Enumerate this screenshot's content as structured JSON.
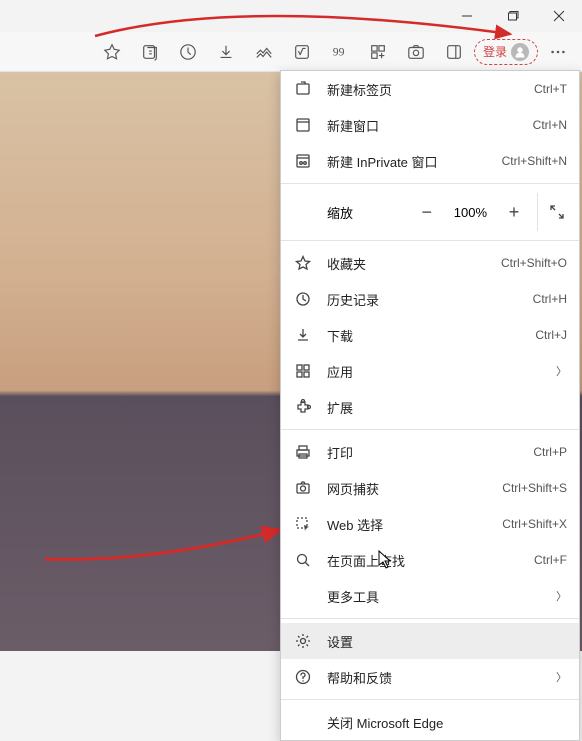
{
  "titlebar": {
    "minimize": "−",
    "maximize": "□",
    "close": "✕"
  },
  "toolbar": {
    "login_label": "登录"
  },
  "menu": {
    "new_tab": "新建标签页",
    "new_tab_sc": "Ctrl+T",
    "new_window": "新建窗口",
    "new_window_sc": "Ctrl+N",
    "new_inprivate": "新建 InPrivate 窗口",
    "new_inprivate_sc": "Ctrl+Shift+N",
    "zoom_label": "缩放",
    "zoom_value": "100%",
    "favorites": "收藏夹",
    "favorites_sc": "Ctrl+Shift+O",
    "history": "历史记录",
    "history_sc": "Ctrl+H",
    "downloads": "下载",
    "downloads_sc": "Ctrl+J",
    "apps": "应用",
    "extensions": "扩展",
    "print": "打印",
    "print_sc": "Ctrl+P",
    "web_capture": "网页捕获",
    "web_capture_sc": "Ctrl+Shift+S",
    "web_select": "Web 选择",
    "web_select_sc": "Ctrl+Shift+X",
    "find": "在页面上查找",
    "find_sc": "Ctrl+F",
    "more_tools": "更多工具",
    "settings": "设置",
    "help": "帮助和反馈",
    "close_edge": "关闭 Microsoft Edge"
  },
  "accent_arrow_color": "#d42a2a"
}
